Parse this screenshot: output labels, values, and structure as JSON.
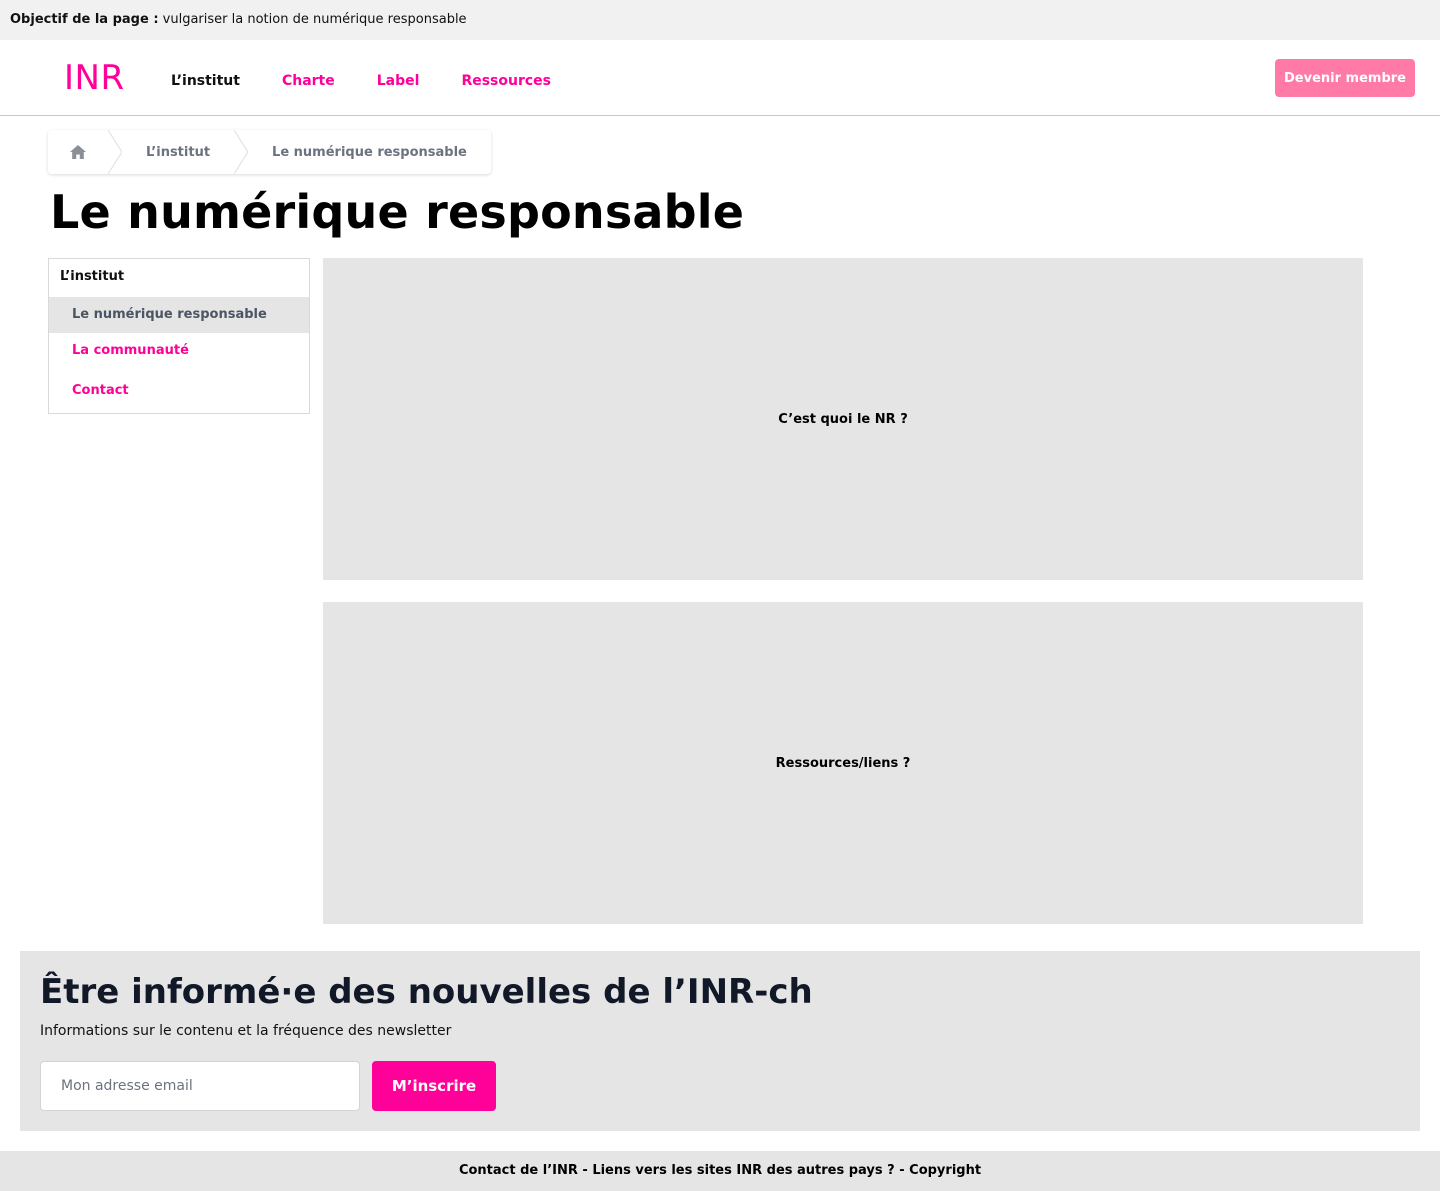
{
  "objective": {
    "label": "Objectif de la page :",
    "text": "vulgariser la notion de numérique responsable"
  },
  "header": {
    "logo": "INR",
    "nav": [
      {
        "label": "L’institut",
        "active": true
      },
      {
        "label": "Charte",
        "active": false
      },
      {
        "label": "Label",
        "active": false
      },
      {
        "label": "Ressources",
        "active": false
      }
    ],
    "cta_label": "Devenir membre"
  },
  "breadcrumb": {
    "home_icon": "home-icon",
    "items": [
      "L’institut",
      "Le numérique responsable"
    ]
  },
  "page": {
    "title": "Le numérique responsable"
  },
  "sidenav": {
    "title": "L’institut",
    "items": [
      {
        "label": "Le numérique responsable",
        "current": true
      },
      {
        "label": "La communauté",
        "current": false
      },
      {
        "label": "Contact",
        "current": false
      }
    ]
  },
  "content": {
    "blocks": [
      "C’est quoi le NR ?",
      "Ressources/liens ?"
    ]
  },
  "newsletter": {
    "title": "Être informé·e des nouvelles de l’INR-ch",
    "description": "Informations sur le contenu et la fréquence des newsletter",
    "email_placeholder": "Mon adresse email",
    "email_value": "",
    "button_label": "M’inscrire"
  },
  "footer": {
    "text": "Contact de l’INR - Liens vers les sites INR des autres pays ? - Copyright"
  },
  "colors": {
    "accent": "#ff0099",
    "cta": "#ff7aa6",
    "panel": "#e5e5e5",
    "objective_bg": "#f1f1f1"
  }
}
